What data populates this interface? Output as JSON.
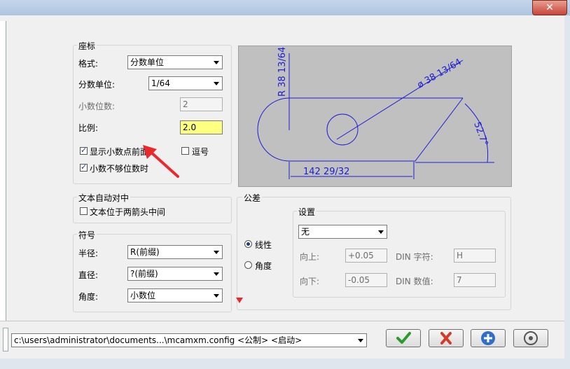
{
  "window": {
    "close_glyph": "✕"
  },
  "coords": {
    "group_label": "座标",
    "format_label": "格式:",
    "format_value": "分数单位",
    "fraction_label": "分数单位:",
    "fraction_value": "1/64",
    "decimals_label": "小数位数:",
    "decimals_value": "2",
    "scale_label": "比例:",
    "scale_value": "2.0",
    "leading_zero_label": "显示小数点前面",
    "comma_label": "逗号",
    "trailing_zero_label": "小数不够位数时"
  },
  "text_center": {
    "group_label": "文本自动对中",
    "between_arrows_label": "文本位于两箭头中间"
  },
  "symbols": {
    "group_label": "符号",
    "radius_label": "半径:",
    "radius_value": "R(前缀)",
    "diameter_label": "直径:",
    "diameter_value": "?(前缀)",
    "angle_label": "角度:",
    "angle_value": "小数位"
  },
  "tolerance": {
    "group_label": "公差",
    "settings_label": "设置",
    "linear_label": "线性",
    "angular_label": "角度",
    "mode_value": "无",
    "upper_label": "向上:",
    "upper_value": "+0.05",
    "lower_label": "向下:",
    "lower_value": "-0.05",
    "din_char_label": "DIN 字符:",
    "din_char_value": "H",
    "din_value_label": "DIN 数值:",
    "din_value_value": "7"
  },
  "preview": {
    "radius_text": "R 38 13/64",
    "diameter_text": "ø 38 13/64",
    "angle_text": "52.7°",
    "length_text": "142 29/32",
    "line_color": "#1b1bd6"
  },
  "footer": {
    "config_path": "c:\\users\\administrator\\documents...\\mcamxm.config <公制> <启动>"
  },
  "colors": {
    "ok_green": "#2c9a2c",
    "cancel_red": "#d23a2a",
    "help_blue": "#2f6fc9",
    "annotation_red": "#e8292e"
  }
}
